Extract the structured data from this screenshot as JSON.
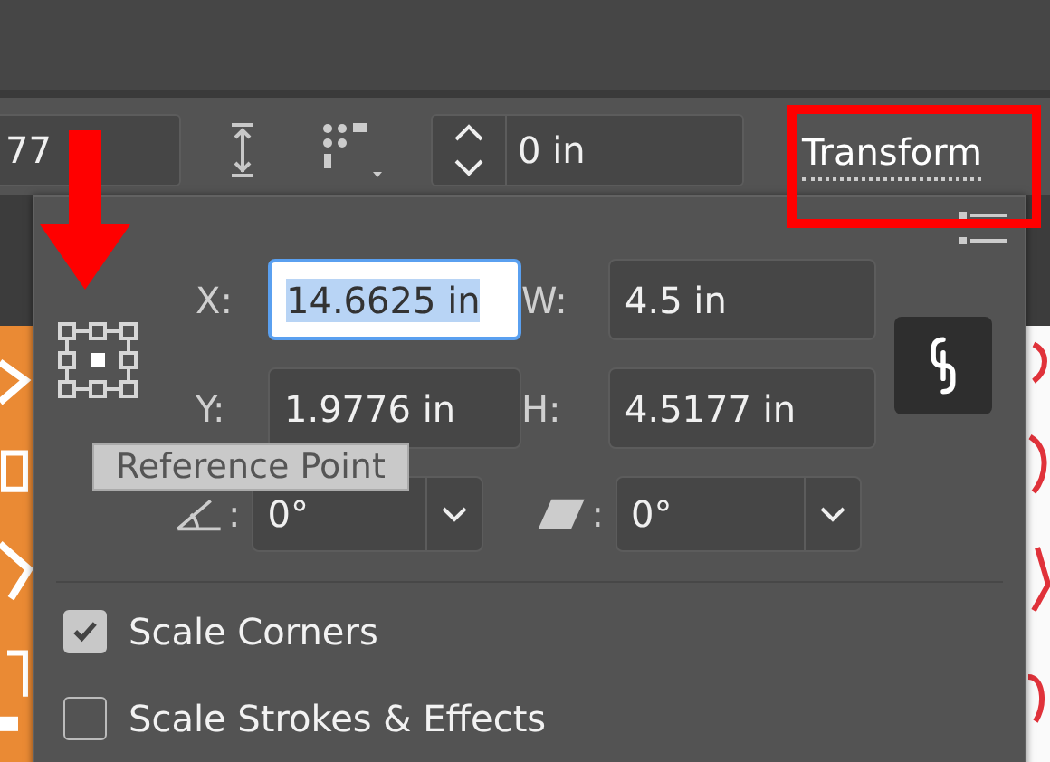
{
  "toolbar": {
    "partial_field": {
      "value": "77"
    },
    "stepper_field": {
      "value": "0 in"
    },
    "panel_link": {
      "label": "Transform"
    }
  },
  "panel": {
    "tooltip": "Reference Point",
    "fields": [
      {
        "label": "X:",
        "value": "14.6625 in",
        "selected": true
      },
      {
        "label": "W:",
        "value": "4.5 in",
        "selected": false
      },
      {
        "label": "Y:",
        "value": "1.9776 in",
        "selected": false
      },
      {
        "label": "H:",
        "value": "4.5177 in",
        "selected": false
      }
    ],
    "angles": [
      {
        "kind": "rotate",
        "separator": ":",
        "value": "0°"
      },
      {
        "kind": "shear",
        "separator": ":",
        "value": "0°"
      }
    ],
    "options": [
      {
        "label": "Scale Corners",
        "checked": true
      },
      {
        "label": "Scale Strokes & Effects",
        "checked": false
      }
    ]
  }
}
